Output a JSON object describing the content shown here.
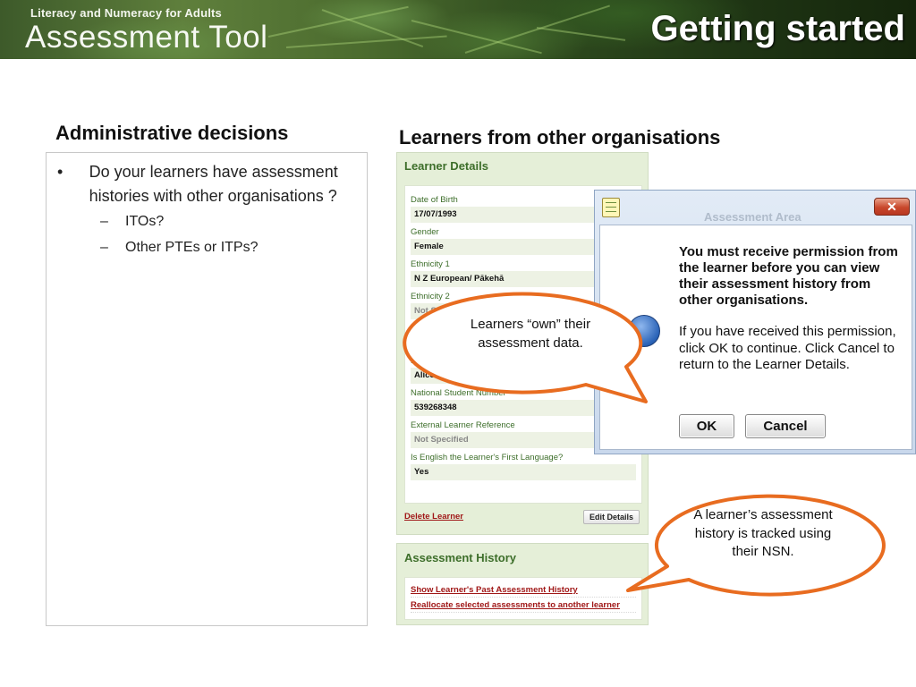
{
  "banner": {
    "subtitle": "Literacy and Numeracy for Adults",
    "tool_name": "Assessment Tool",
    "slide_title": "Getting started"
  },
  "left": {
    "heading": "Administrative decisions",
    "bullet": "Do your learners have assessment histories with other organisations ?",
    "subbullets": [
      "ITOs?",
      "Other PTEs or ITPs?"
    ]
  },
  "right": {
    "heading": "Learners from other organisations"
  },
  "learner_details": {
    "title": "Learner Details",
    "fields": [
      {
        "label": "Date of Birth",
        "value": "17/07/1993"
      },
      {
        "label": "Gender",
        "value": "Female"
      },
      {
        "label": "Ethnicity 1",
        "value": "N Z European/ Pākehā"
      },
      {
        "label": "Ethnicity 2",
        "value": "Not S"
      },
      {
        "label": "E",
        "value": ""
      },
      {
        "label": "E",
        "value": "Alice.A"
      },
      {
        "label": "National Student Number",
        "value": "539268348"
      },
      {
        "label": "External Learner Reference",
        "value": "Not Specified"
      },
      {
        "label": "Is English the Learner's First Language?",
        "value": "Yes"
      }
    ],
    "delete_link": "Delete Learner",
    "edit_button": "Edit Details"
  },
  "assessment_history": {
    "title": "Assessment History",
    "links": [
      "Show Learner's Past Assessment History",
      "Reallocate selected assessments to another learner"
    ]
  },
  "dialog": {
    "caption": "Assessment Area",
    "close_label": "✕",
    "message_bold": "You must receive permission from the learner before you can view their assessment history from other organisations.",
    "message_plain": "If you have received this permission, click OK to continue. Click Cancel to return to the Learner Details.",
    "ok_label": "OK",
    "cancel_label": "Cancel",
    "icon": "info-icon"
  },
  "callouts": {
    "own_data": "Learners “own” their assessment data.",
    "nsn": "A learner’s assessment history is tracked using their  NSN."
  },
  "colors": {
    "callout_border": "#e86c20",
    "panel_title": "#3d6e2a",
    "link": "#a01818"
  }
}
